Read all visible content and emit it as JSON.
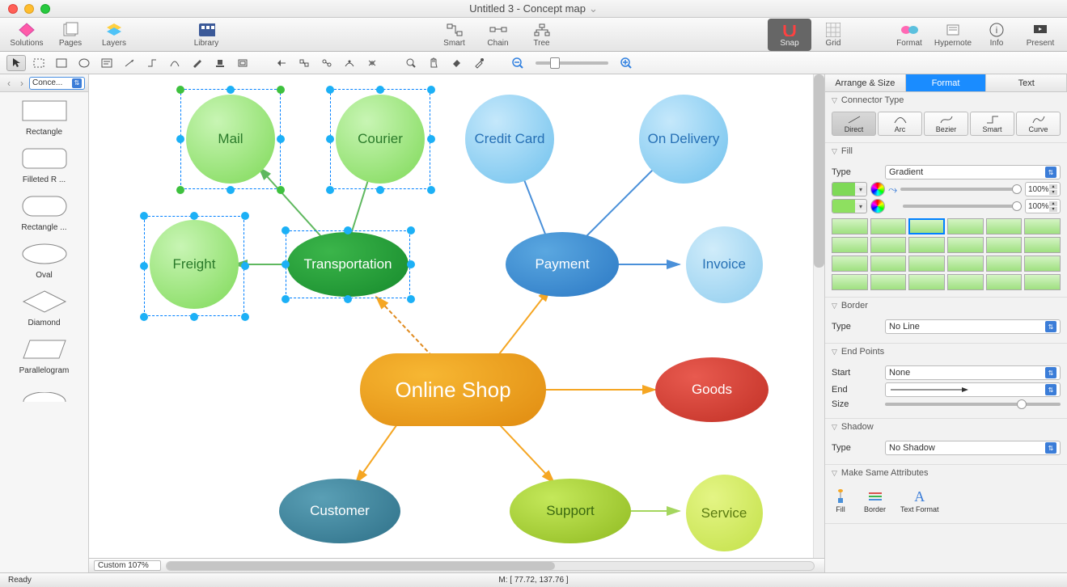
{
  "window_title": "Untitled 3 - Concept map",
  "toolbar_main": {
    "solutions": "Solutions",
    "pages": "Pages",
    "layers": "Layers",
    "library": "Library",
    "smart": "Smart",
    "chain": "Chain",
    "tree": "Tree",
    "snap": "Snap",
    "grid": "Grid",
    "format": "Format",
    "hypernote": "Hypernote",
    "info": "Info",
    "present": "Present"
  },
  "sidebar": {
    "selector": "Conce...",
    "shapes": [
      {
        "label": "Rectangle"
      },
      {
        "label": "Filleted R ..."
      },
      {
        "label": "Rectangle ..."
      },
      {
        "label": "Oval"
      },
      {
        "label": "Diamond"
      },
      {
        "label": "Parallelogram"
      }
    ]
  },
  "nodes": {
    "mail": "Mail",
    "courier": "Courier",
    "freight": "Freight",
    "transportation": "Transportation",
    "creditcard": "Credit Card",
    "ondelivery": "On Delivery",
    "payment": "Payment",
    "invoice": "Invoice",
    "onlineshop": "Online Shop",
    "goods": "Goods",
    "customer": "Customer",
    "support": "Support",
    "service": "Service"
  },
  "inspector": {
    "tabs": {
      "arrange": "Arrange & Size",
      "format": "Format",
      "text": "Text"
    },
    "connector": {
      "title": "Connector Type",
      "direct": "Direct",
      "arc": "Arc",
      "bezier": "Bezier",
      "smart": "Smart",
      "curve": "Curve"
    },
    "fill": {
      "title": "Fill",
      "type_lbl": "Type",
      "type_val": "Gradient",
      "pct": "100%"
    },
    "border": {
      "title": "Border",
      "type_lbl": "Type",
      "type_val": "No Line"
    },
    "endpoints": {
      "title": "End Points",
      "start_lbl": "Start",
      "start_val": "None",
      "end_lbl": "End",
      "size_lbl": "Size"
    },
    "shadow": {
      "title": "Shadow",
      "type_lbl": "Type",
      "type_val": "No Shadow"
    },
    "same": {
      "title": "Make Same Attributes",
      "fill": "Fill",
      "border": "Border",
      "text": "Text Format"
    }
  },
  "zoom": "Custom 107%",
  "status_ready": "Ready",
  "status_coord": "M: [ 77.72, 137.76 ]"
}
